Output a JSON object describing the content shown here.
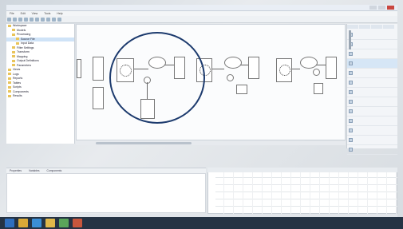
{
  "window": {
    "title": ""
  },
  "menubar": {
    "items": [
      "File",
      "Edit",
      "View",
      "Tools",
      "Help"
    ]
  },
  "tree": {
    "items": [
      {
        "label": "Workspace",
        "indent": 0
      },
      {
        "label": "Models",
        "indent": 1
      },
      {
        "label": "Processing",
        "indent": 1
      },
      {
        "label": "Source File",
        "indent": 2,
        "selected": true
      },
      {
        "label": "Input Data",
        "indent": 2
      },
      {
        "label": "Filter Settings",
        "indent": 1
      },
      {
        "label": "Transform",
        "indent": 1
      },
      {
        "label": "Mapping",
        "indent": 1
      },
      {
        "label": "Output Definitions",
        "indent": 1
      },
      {
        "label": "Parameters",
        "indent": 1
      },
      {
        "label": "Views",
        "indent": 0
      },
      {
        "label": "Logs",
        "indent": 0
      },
      {
        "label": "Reports",
        "indent": 0
      },
      {
        "label": "Tables",
        "indent": 0
      },
      {
        "label": "Scripts",
        "indent": 0
      },
      {
        "label": "Components",
        "indent": 0
      },
      {
        "label": "Results",
        "indent": 0
      }
    ]
  },
  "right_panel": {
    "tabs": [
      "",
      "",
      "",
      ""
    ],
    "items": [
      {
        "label": "",
        "selected": false
      },
      {
        "label": "",
        "selected": false
      },
      {
        "label": "",
        "selected": false
      },
      {
        "label": "",
        "selected": true
      },
      {
        "label": "",
        "selected": false
      },
      {
        "label": "",
        "selected": false
      },
      {
        "label": "",
        "selected": false
      },
      {
        "label": "",
        "selected": false
      },
      {
        "label": "",
        "selected": false
      },
      {
        "label": "",
        "selected": false
      },
      {
        "label": "",
        "selected": false
      },
      {
        "label": "",
        "selected": false
      },
      {
        "label": "",
        "selected": false
      }
    ]
  },
  "bottom": {
    "tabs": [
      "Properties",
      "Variables",
      "Components"
    ],
    "description": ""
  },
  "grid": {
    "row_labels": [
      "",
      "",
      "",
      "",
      ""
    ]
  },
  "taskbar": {
    "apps": [
      {
        "name": "start-icon",
        "color": "#2f6fbf"
      },
      {
        "name": "explorer-icon",
        "color": "#d9a937"
      },
      {
        "name": "browser-icon",
        "color": "#3a8ed6"
      },
      {
        "name": "folder-icon",
        "color": "#e0b84a"
      },
      {
        "name": "app-icon",
        "color": "#5aa55a"
      },
      {
        "name": "tool-icon",
        "color": "#c7563d"
      }
    ],
    "tray_text": "",
    "clock_time": "",
    "clock_date": ""
  },
  "colors": {
    "annotation_circle": "#1d3b6e",
    "taskbar": "#253344"
  }
}
